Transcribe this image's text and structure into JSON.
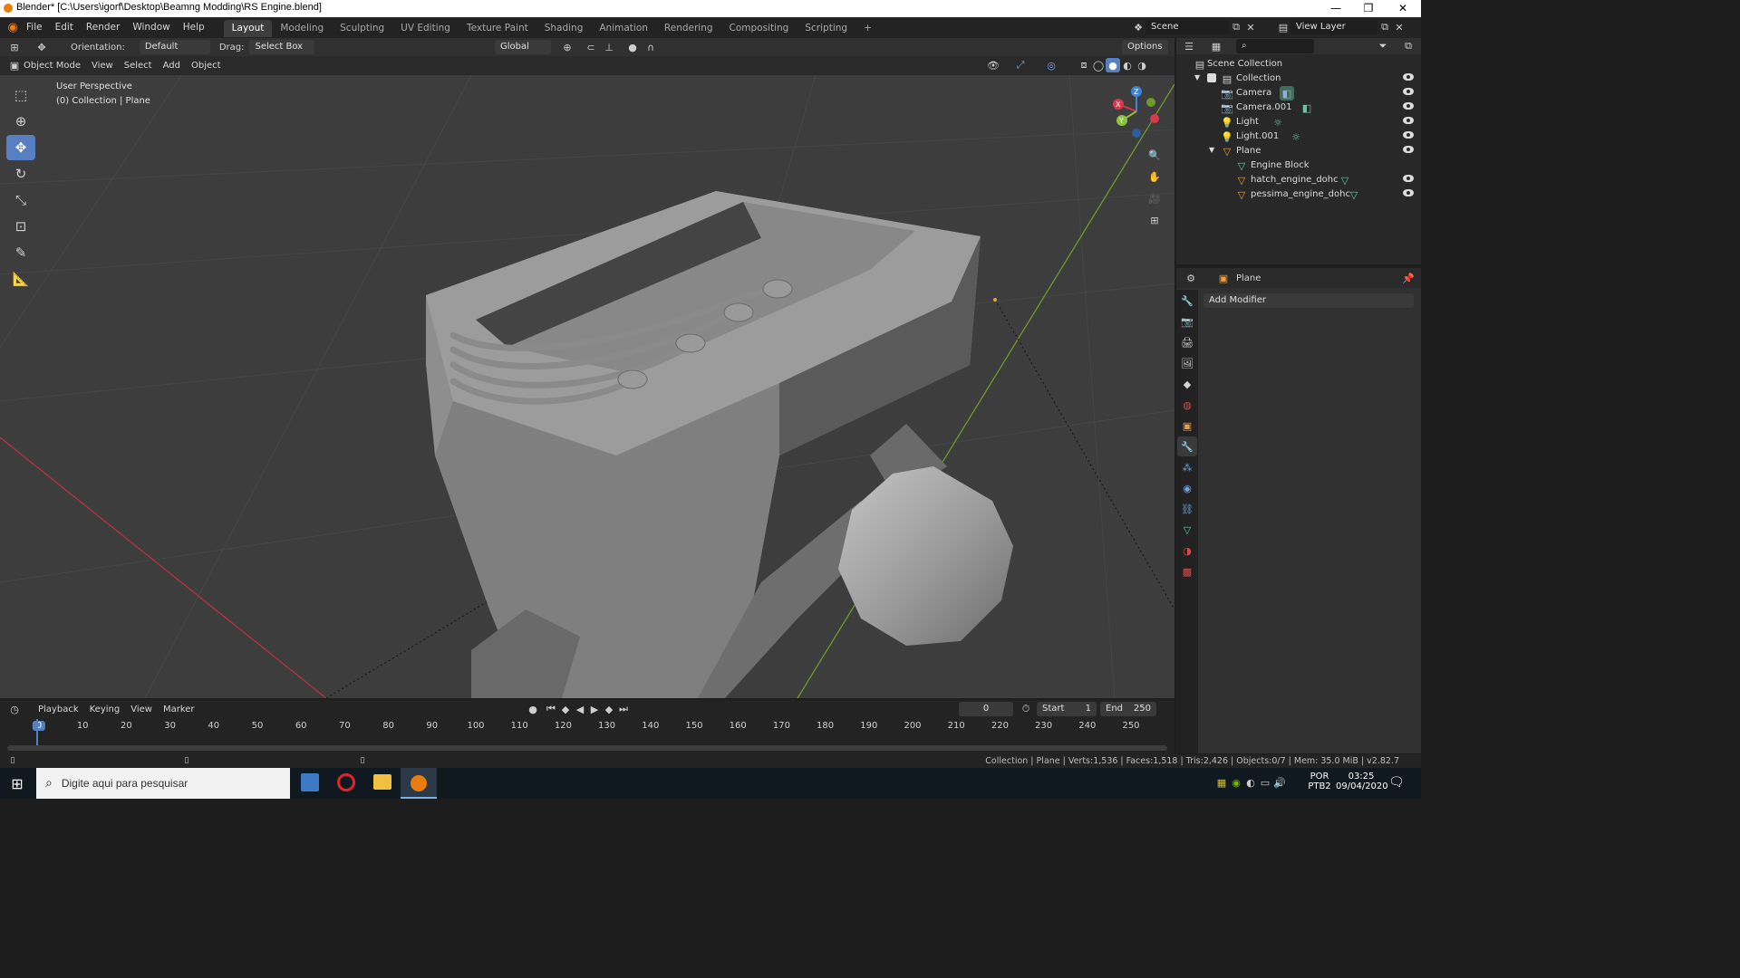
{
  "window": {
    "title": "Blender* [C:\\Users\\igorf\\Desktop\\Beamng Modding\\RS Engine.blend]",
    "minimize": "—",
    "maximize": "❐",
    "close": "✕"
  },
  "menu": [
    "File",
    "Edit",
    "Render",
    "Window",
    "Help"
  ],
  "workspaces": [
    "Layout",
    "Modeling",
    "Sculpting",
    "UV Editing",
    "Texture Paint",
    "Shading",
    "Animation",
    "Rendering",
    "Compositing",
    "Scripting"
  ],
  "workspace_add": "+",
  "scene": {
    "name": "Scene",
    "view_layer": "View Layer"
  },
  "tool_header": {
    "orientation_label": "Orientation:",
    "orientation_value": "Default",
    "drag_label": "Drag:",
    "drag_value": "Select Box",
    "transform_orientation": "Global",
    "options": "Options"
  },
  "viewport_header": {
    "mode": "Object Mode",
    "menus": [
      "View",
      "Select",
      "Add",
      "Object"
    ]
  },
  "viewport": {
    "perspective": "User Perspective",
    "collection_info": "(0) Collection | Plane",
    "gizmo": {
      "x": "X",
      "y": "Y",
      "z": "Z",
      "x_color": "#d8394a",
      "y_color": "#8ac43e",
      "z_color": "#3d83d8"
    }
  },
  "outliner": {
    "root": "Scene Collection",
    "items": [
      {
        "label": "Collection",
        "level": 1,
        "icon": "collection-icon"
      },
      {
        "label": "Camera",
        "level": 2,
        "icon": "camera-icon"
      },
      {
        "label": "Camera.001",
        "level": 2,
        "icon": "camera-icon"
      },
      {
        "label": "Light",
        "level": 2,
        "icon": "light-icon"
      },
      {
        "label": "Light.001",
        "level": 2,
        "icon": "light-icon"
      },
      {
        "label": "Plane",
        "level": 2,
        "icon": "mesh-icon"
      },
      {
        "label": "Engine Block",
        "level": 3,
        "icon": "mesh-data-icon"
      },
      {
        "label": "hatch_engine_dohc",
        "level": 3,
        "icon": "mesh-icon"
      },
      {
        "label": "pessima_engine_dohc",
        "level": 3,
        "icon": "mesh-icon"
      }
    ]
  },
  "properties": {
    "object_name": "Plane",
    "add_modifier": "Add Modifier"
  },
  "timeline": {
    "menus": [
      "Playback",
      "Keying",
      "View",
      "Marker"
    ],
    "current_frame": "0",
    "start_label": "Start",
    "start": "1",
    "end_label": "End",
    "end": "250",
    "ticks": [
      "0",
      "10",
      "20",
      "30",
      "40",
      "50",
      "60",
      "70",
      "80",
      "90",
      "100",
      "110",
      "120",
      "130",
      "140",
      "150",
      "160",
      "170",
      "180",
      "190",
      "200",
      "210",
      "220",
      "230",
      "240",
      "250"
    ]
  },
  "status": {
    "stats": "Collection | Plane | Verts:1,536 | Faces:1,518 | Tris:2,426 | Objects:0/7 | Mem: 35.0 MiB | v2.82.7"
  },
  "taskbar": {
    "search_placeholder": "Digite aqui para pesquisar",
    "lang1": "POR",
    "lang2": "PTB2",
    "time": "03:25",
    "date": "09/04/2020"
  },
  "colors": {
    "accent": "#5680c2",
    "orange": "#e87d0d",
    "x_axis": "#d8394a",
    "y_axis": "#8ac43e"
  }
}
